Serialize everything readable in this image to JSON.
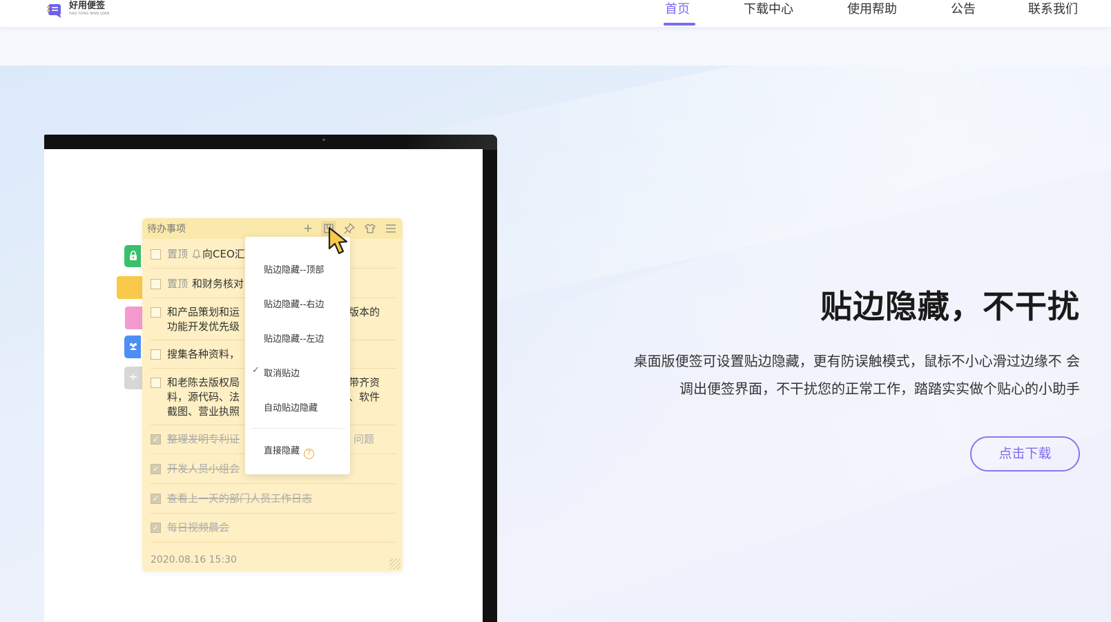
{
  "header": {
    "logo_cn": "好用便签",
    "logo_en": "HAO YONG BIAN QIAN",
    "nav": [
      {
        "label": "首页",
        "active": true
      },
      {
        "label": "下载中心",
        "active": false
      },
      {
        "label": "使用帮助",
        "active": false
      },
      {
        "label": "公告",
        "active": false
      },
      {
        "label": "联系我们",
        "active": false
      }
    ],
    "accent_color": "#7b6cf0"
  },
  "note": {
    "title": "待办事项",
    "tools": [
      "plus-icon",
      "dock-icon",
      "pin-icon",
      "shirt-icon",
      "menu-icon"
    ],
    "tasks": [
      {
        "pin": "置顶",
        "text": "向CEO汇",
        "checked": false,
        "bell": true
      },
      {
        "pin": "置顶",
        "text": "和财务核对",
        "checked": false
      },
      {
        "text": "和产品策划和运",
        "text_right": "个版本的",
        "line2": "功能开发优先级",
        "checked": false
      },
      {
        "text": "搜集各种资料，",
        "checked": false
      },
      {
        "text": "和老陈去版权局",
        "text_right": "带齐资",
        "line2": "料，源代码、法",
        "line2_right": "牛、软件",
        "line3": "截图、营业执照",
        "checked": false
      },
      {
        "text": "整理发明专利证",
        "text_right": "问题",
        "checked": true
      },
      {
        "text": "开发人员小组会",
        "checked": true
      },
      {
        "text": "查看上一天的部门人员工作日志",
        "checked": true
      },
      {
        "text": "每日视频晨会",
        "checked": true
      }
    ],
    "date": "2020.08.16  15:30"
  },
  "menu": {
    "items": [
      "贴边隐藏--顶部",
      "贴边隐藏--右边",
      "贴边隐藏--左边",
      "取消贴边",
      "自动贴边隐藏"
    ],
    "checked_index": 3,
    "hide_label": "直接隐藏",
    "help": "?"
  },
  "hero": {
    "headline": "贴边隐藏，不干扰",
    "desc_line1": "桌面版便签可设置贴边隐藏，更有防误触模式，鼠标不小心滑过边缘不 会",
    "desc_line2": "调出便签界面，不干扰您的正常工作，踏踏实实做个贴心的小助手",
    "cta": "点击下载"
  }
}
